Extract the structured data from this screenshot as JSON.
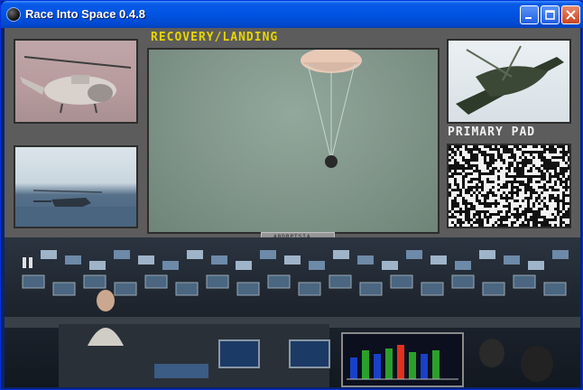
{
  "window": {
    "title": "Race Into Space 0.4.8",
    "buttons": [
      "minimize",
      "maximize",
      "close"
    ]
  },
  "screen": {
    "main_feed_label": "RECOVERY/LANDING",
    "side_feed_label": "PRIMARY PAD",
    "control_plate_label": "ABDRPTSIA"
  },
  "colors": {
    "label_yellow": "#e9d400",
    "titlebar_blue": "#0054e3",
    "close_red": "#c7451f",
    "panel_gray": "#727272"
  },
  "icons": {
    "app": "app-globe-icon",
    "pause": "pause-icon",
    "control_buttons": [
      "rewind-icon",
      "play-icon",
      "step-icon",
      "fast-forward-icon"
    ]
  },
  "status_board": {
    "bars": [
      {
        "color": "#1840c8",
        "level": 0.6
      },
      {
        "color": "#2aa02a",
        "level": 0.8
      },
      {
        "color": "#1840c8",
        "level": 0.7
      },
      {
        "color": "#2aa02a",
        "level": 0.85
      },
      {
        "color": "#e0301e",
        "level": 0.95
      },
      {
        "color": "#2aa02a",
        "level": 0.75
      },
      {
        "color": "#1840c8",
        "level": 0.7
      },
      {
        "color": "#2aa02a",
        "level": 0.8
      }
    ]
  }
}
